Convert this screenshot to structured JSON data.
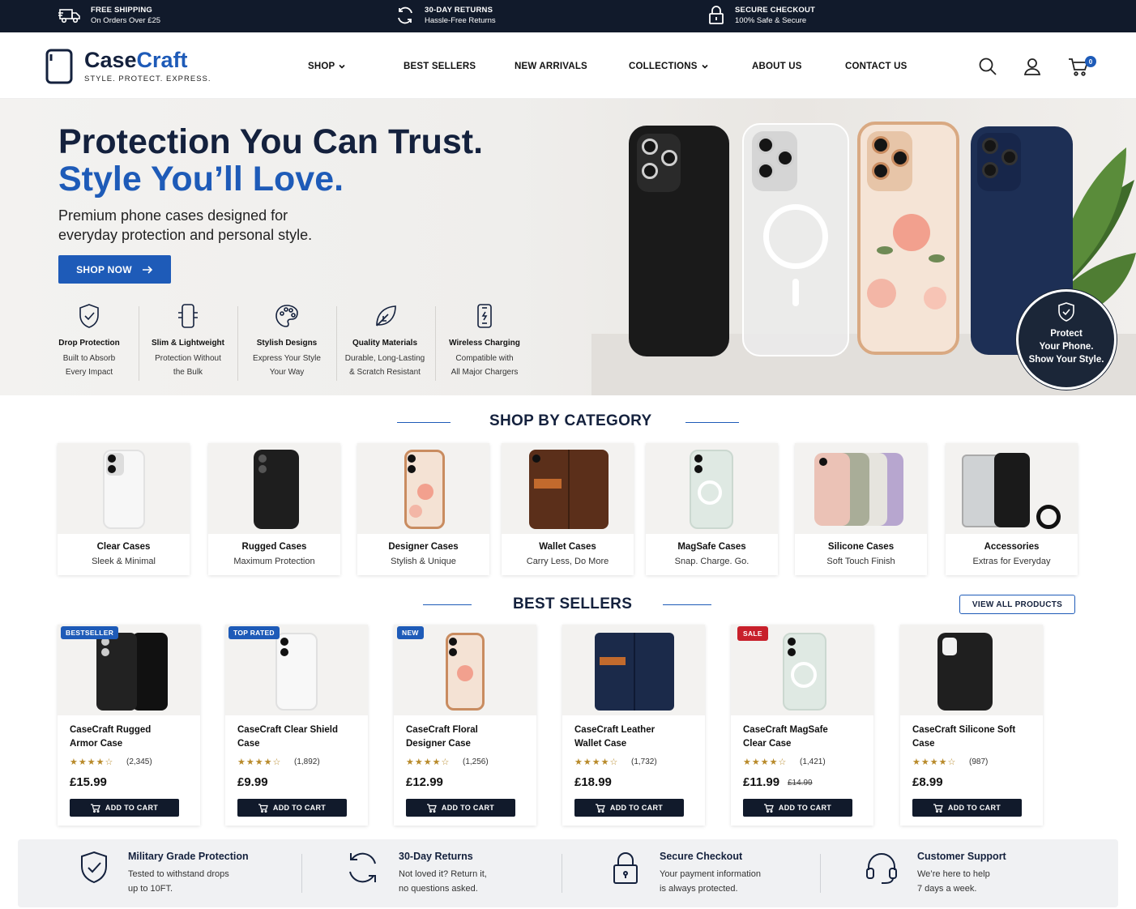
{
  "topbar": [
    {
      "icon": "truck-icon",
      "title": "FREE SHIPPING",
      "sub": "On Orders Over £25"
    },
    {
      "icon": "returns-icon",
      "title": "30-DAY RETURNS",
      "sub": "Hassle-Free Returns"
    },
    {
      "icon": "lock-icon",
      "title": "SECURE CHECKOUT",
      "sub": "100% Safe & Secure"
    }
  ],
  "brand": {
    "name_a": "Case",
    "name_b": "Craft",
    "tagline": "STYLE. PROTECT. EXPRESS."
  },
  "nav": [
    "SHOP",
    "BEST SELLERS",
    "NEW ARRIVALS",
    "COLLECTIONS",
    "ABOUT US",
    "CONTACT US"
  ],
  "cart_count": "0",
  "hero": {
    "line1": "Protection You Can Trust.",
    "line2": "Style You’ll Love.",
    "desc": "Premium phone cases designed for everyday protection and personal style.",
    "cta": "SHOP NOW",
    "seal": {
      "l1": "Protect",
      "l2": "Your Phone.",
      "l3": "Show Your Style."
    }
  },
  "features": [
    {
      "icon": "shield-icon",
      "title": "Drop Protection",
      "l1": "Built to Absorb",
      "l2": "Every Impact"
    },
    {
      "icon": "slim-phone-icon",
      "title": "Slim & Lightweight",
      "l1": "Protection Without",
      "l2": "the Bulk"
    },
    {
      "icon": "palette-icon",
      "title": "Stylish Designs",
      "l1": "Express Your Style",
      "l2": "Your Way"
    },
    {
      "icon": "leaf-icon",
      "title": "Quality Materials",
      "l1": "Durable, Long-Lasting",
      "l2": "& Scratch Resistant"
    },
    {
      "icon": "wireless-charging-icon",
      "title": "Wireless Charging",
      "l1": "Compatible with",
      "l2": "All Major Chargers"
    }
  ],
  "categories_title": "SHOP BY CATEGORY",
  "categories": [
    {
      "name": "Clear Cases",
      "sub": "Sleek & Minimal"
    },
    {
      "name": "Rugged Cases",
      "sub": "Maximum Protection"
    },
    {
      "name": "Designer Cases",
      "sub": "Stylish & Unique"
    },
    {
      "name": "Wallet Cases",
      "sub": "Carry Less, Do More"
    },
    {
      "name": "MagSafe Cases",
      "sub": "Snap. Charge. Go."
    },
    {
      "name": "Silicone Cases",
      "sub": "Soft Touch Finish"
    },
    {
      "name": "Accessories",
      "sub": "Extras for Everyday"
    }
  ],
  "bestsellers_title": "BEST SELLERS",
  "view_all": "VIEW ALL PRODUCTS",
  "add_to_cart": "ADD TO CART",
  "products": [
    {
      "badge": "BESTSELLER",
      "badge_color": "#1e5bb8",
      "name": "CaseCraft Rugged Armor Case",
      "stars": "★★★★☆",
      "rating": 4.5,
      "reviews": "(2,345)",
      "price": "£15.99",
      "old_price": ""
    },
    {
      "badge": "TOP RATED",
      "badge_color": "#1e5bb8",
      "name": "CaseCraft Clear Shield Case",
      "stars": "★★★★☆",
      "rating": 4.5,
      "reviews": "(1,892)",
      "price": "£9.99",
      "old_price": ""
    },
    {
      "badge": "NEW",
      "badge_color": "#1e5bb8",
      "name": "CaseCraft Floral Designer Case",
      "stars": "★★★★☆",
      "rating": 4.5,
      "reviews": "(1,256)",
      "price": "£12.99",
      "old_price": ""
    },
    {
      "badge": "",
      "badge_color": "",
      "name": "CaseCraft Leather Wallet Case",
      "stars": "★★★★☆",
      "rating": 4.5,
      "reviews": "(1,732)",
      "price": "£18.99",
      "old_price": ""
    },
    {
      "badge": "SALE",
      "badge_color": "#c8202b",
      "name": "CaseCraft MagSafe Clear Case",
      "stars": "★★★★☆",
      "rating": 4.5,
      "reviews": "(1,421)",
      "price": "£11.99",
      "old_price": "£14.99"
    },
    {
      "badge": "",
      "badge_color": "",
      "name": "CaseCraft Silicone Soft Case",
      "stars": "★★★★☆",
      "rating": 4.5,
      "reviews": "(987)",
      "price": "£8.99",
      "old_price": ""
    }
  ],
  "guarantees": [
    {
      "icon": "shield-check-icon",
      "title": "Military Grade Protection",
      "l1": "Tested to withstand drops",
      "l2": "up to 10FT."
    },
    {
      "icon": "returns-icon",
      "title": "30-Day Returns",
      "l1": "Not loved it? Return it,",
      "l2": "no questions asked."
    },
    {
      "icon": "lock-icon",
      "title": "Secure Checkout",
      "l1": "Your payment information",
      "l2": "is always protected."
    },
    {
      "icon": "headset-icon",
      "title": "Customer Support",
      "l1": "We’re here to help",
      "l2": "7 days a week."
    }
  ],
  "colors": {
    "navy": "#14213d",
    "accent": "#1e5bb8",
    "dark": "#111a2b",
    "sale": "#c8202b",
    "star": "#b88a2a"
  }
}
